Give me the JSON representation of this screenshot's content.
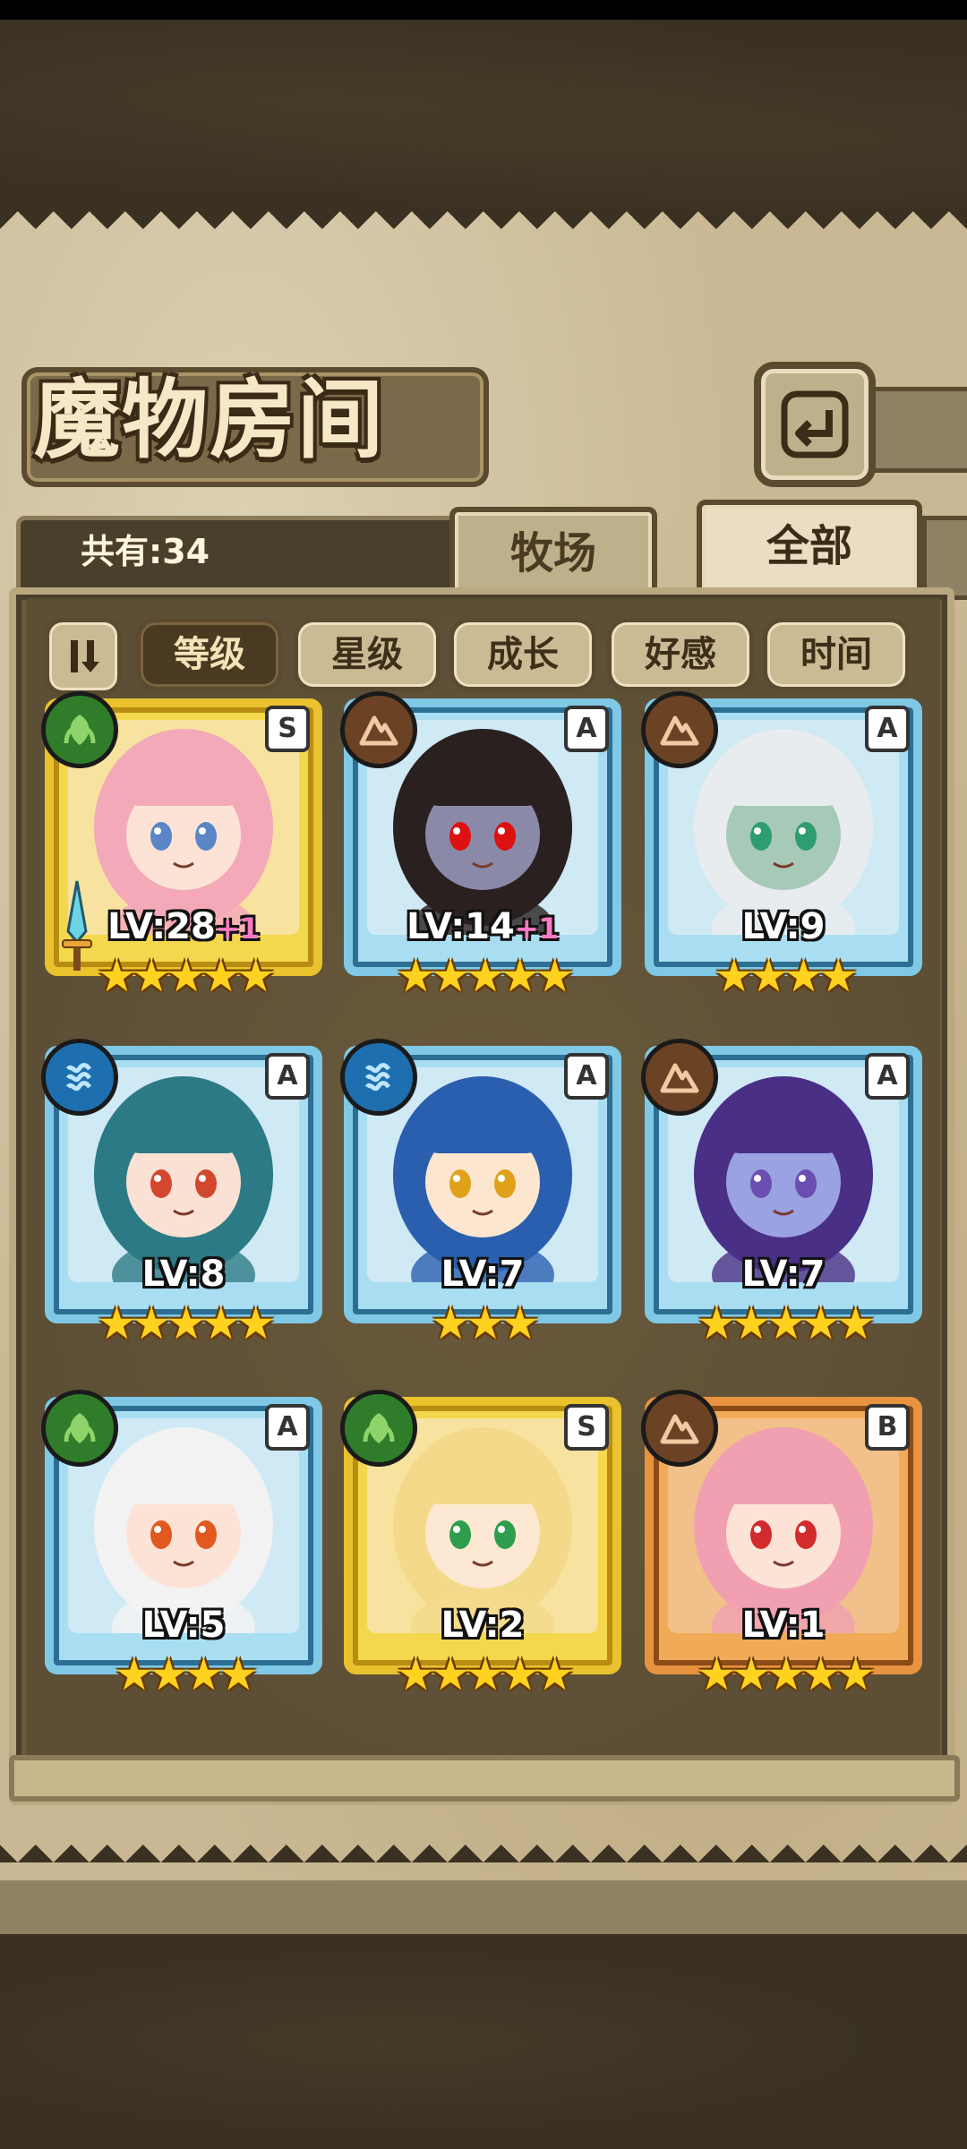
{
  "header": {
    "title": "魔物房间"
  },
  "summary": {
    "count_label": "共有:34"
  },
  "tabs": [
    {
      "label": "牧场",
      "active": false
    },
    {
      "label": "全部",
      "active": true
    }
  ],
  "sort_buttons": [
    {
      "label": "等级",
      "active": true
    },
    {
      "label": "星级",
      "active": false
    },
    {
      "label": "成长",
      "active": false
    },
    {
      "label": "好感",
      "active": false
    },
    {
      "label": "时间",
      "active": false
    }
  ],
  "monsters": [
    {
      "rank": "S",
      "element": "leaf-icon",
      "level": "LV:28",
      "bonus": "+1",
      "stars": 5,
      "frame": "gold",
      "weapon": true,
      "colors": {
        "hair": "#f4a9b8",
        "skin": "#fde3d6",
        "eyes": "#5a86c7"
      }
    },
    {
      "rank": "A",
      "element": "earth-icon",
      "level": "LV:14",
      "bonus": "+1",
      "stars": 5,
      "frame": "blue",
      "weapon": false,
      "colors": {
        "hair": "#2b2020",
        "skin": "#8a8aa8",
        "eyes": "#d11"
      }
    },
    {
      "rank": "A",
      "element": "earth-icon",
      "level": "LV:9",
      "bonus": "",
      "stars": 4,
      "frame": "blue",
      "weapon": false,
      "colors": {
        "hair": "#e8ecef",
        "skin": "#a7c9b7",
        "eyes": "#2e9e6e"
      }
    },
    {
      "rank": "A",
      "element": "water-icon",
      "level": "LV:8",
      "bonus": "",
      "stars": 5,
      "frame": "blue",
      "weapon": false,
      "colors": {
        "hair": "#2c7a86",
        "skin": "#fbe1d3",
        "eyes": "#d2482e"
      }
    },
    {
      "rank": "A",
      "element": "water-icon",
      "level": "LV:7",
      "bonus": "",
      "stars": 3,
      "frame": "blue",
      "weapon": false,
      "colors": {
        "hair": "#2a5fb0",
        "skin": "#fde6cf",
        "eyes": "#e0a21a"
      }
    },
    {
      "rank": "A",
      "element": "earth-icon",
      "level": "LV:7",
      "bonus": "",
      "stars": 5,
      "frame": "blue",
      "weapon": false,
      "colors": {
        "hair": "#4a2f86",
        "skin": "#9aa2e2",
        "eyes": "#6b4fb0"
      }
    },
    {
      "rank": "A",
      "element": "leaf-icon",
      "level": "LV:5",
      "bonus": "",
      "stars": 4,
      "frame": "blue",
      "weapon": false,
      "colors": {
        "hair": "#f2f2f2",
        "skin": "#fde3d6",
        "eyes": "#e0591f"
      }
    },
    {
      "rank": "S",
      "element": "leaf-icon",
      "level": "LV:2",
      "bonus": "",
      "stars": 5,
      "frame": "gold",
      "weapon": false,
      "colors": {
        "hair": "#f4d98a",
        "skin": "#fde8d3",
        "eyes": "#2e9e4e"
      }
    },
    {
      "rank": "B",
      "element": "earth-icon",
      "level": "LV:1",
      "bonus": "",
      "stars": 5,
      "frame": "bronze",
      "weapon": false,
      "colors": {
        "hair": "#f0a0b0",
        "skin": "#fde3d6",
        "eyes": "#d12b2b"
      }
    }
  ]
}
